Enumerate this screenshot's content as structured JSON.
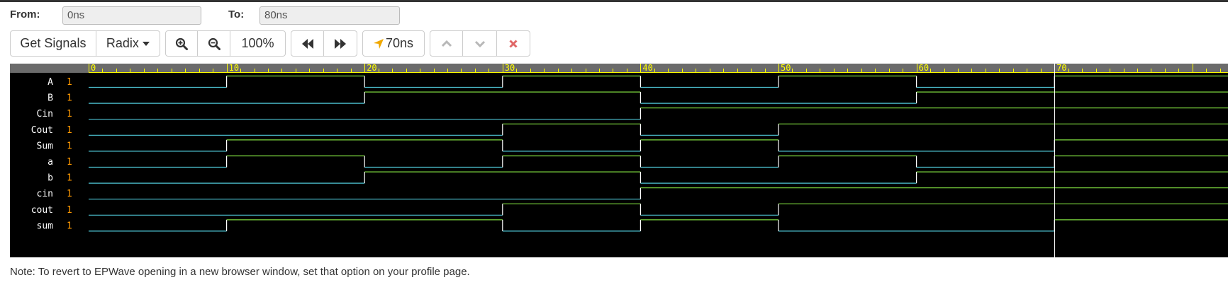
{
  "range": {
    "from_label": "From:",
    "from_value": "0ns",
    "to_label": "To:",
    "to_value": "80ns"
  },
  "toolbar": {
    "get_signals": "Get Signals",
    "radix": "Radix",
    "zoom_level": "100%",
    "cursor_time": "70ns"
  },
  "icons": {
    "radix_caret": "caret-down-icon",
    "zoom_in": "zoom-in-icon",
    "zoom_out": "zoom-out-icon",
    "prev_edge": "fast-backward-icon",
    "next_edge": "fast-forward-icon",
    "cursor": "location-arrow-icon",
    "up": "chevron-up-icon",
    "down": "chevron-down-icon",
    "close": "close-icon"
  },
  "colors": {
    "wave_background": "#000000",
    "ruler_background": "#6b6b6b",
    "ruler_ticks": "#ffff00",
    "signal_high": "#7fdc3f",
    "signal_low": "#4fc8d8",
    "signal_name": "#ffffff",
    "signal_value": "#ff9900",
    "cursor_line": "#ffffff",
    "close_icon": "#e06666"
  },
  "waveform": {
    "time_start": 0,
    "time_end": 80,
    "time_unit": "ns",
    "ruler_labels": [
      "0",
      "10",
      "20",
      "30",
      "40",
      "50",
      "60",
      "70"
    ],
    "cursor_time": 70,
    "signals": [
      {
        "name": "A",
        "value": "1",
        "transitions": [
          [
            0,
            0
          ],
          [
            10,
            1
          ],
          [
            20,
            0
          ],
          [
            30,
            1
          ],
          [
            40,
            0
          ],
          [
            50,
            1
          ],
          [
            60,
            0
          ],
          [
            70,
            1
          ]
        ]
      },
      {
        "name": "B",
        "value": "1",
        "transitions": [
          [
            0,
            0
          ],
          [
            20,
            1
          ],
          [
            40,
            0
          ],
          [
            60,
            1
          ]
        ]
      },
      {
        "name": "Cin",
        "value": "1",
        "transitions": [
          [
            0,
            0
          ],
          [
            40,
            1
          ]
        ]
      },
      {
        "name": "Cout",
        "value": "1",
        "transitions": [
          [
            0,
            0
          ],
          [
            30,
            1
          ],
          [
            40,
            0
          ],
          [
            50,
            1
          ]
        ]
      },
      {
        "name": "Sum",
        "value": "1",
        "transitions": [
          [
            0,
            0
          ],
          [
            10,
            1
          ],
          [
            30,
            0
          ],
          [
            40,
            1
          ],
          [
            50,
            0
          ],
          [
            70,
            1
          ]
        ]
      },
      {
        "name": "a",
        "value": "1",
        "transitions": [
          [
            0,
            0
          ],
          [
            10,
            1
          ],
          [
            20,
            0
          ],
          [
            30,
            1
          ],
          [
            40,
            0
          ],
          [
            50,
            1
          ],
          [
            60,
            0
          ],
          [
            70,
            1
          ]
        ]
      },
      {
        "name": "b",
        "value": "1",
        "transitions": [
          [
            0,
            0
          ],
          [
            20,
            1
          ],
          [
            40,
            0
          ],
          [
            60,
            1
          ]
        ]
      },
      {
        "name": "cin",
        "value": "1",
        "transitions": [
          [
            0,
            0
          ],
          [
            40,
            1
          ]
        ]
      },
      {
        "name": "cout",
        "value": "1",
        "transitions": [
          [
            0,
            0
          ],
          [
            30,
            1
          ],
          [
            40,
            0
          ],
          [
            50,
            1
          ]
        ]
      },
      {
        "name": "sum",
        "value": "1",
        "transitions": [
          [
            0,
            0
          ],
          [
            10,
            1
          ],
          [
            30,
            0
          ],
          [
            40,
            1
          ],
          [
            50,
            0
          ],
          [
            70,
            1
          ]
        ]
      }
    ]
  },
  "note": "Note: To revert to EPWave opening in a new browser window, set that option on your profile page."
}
